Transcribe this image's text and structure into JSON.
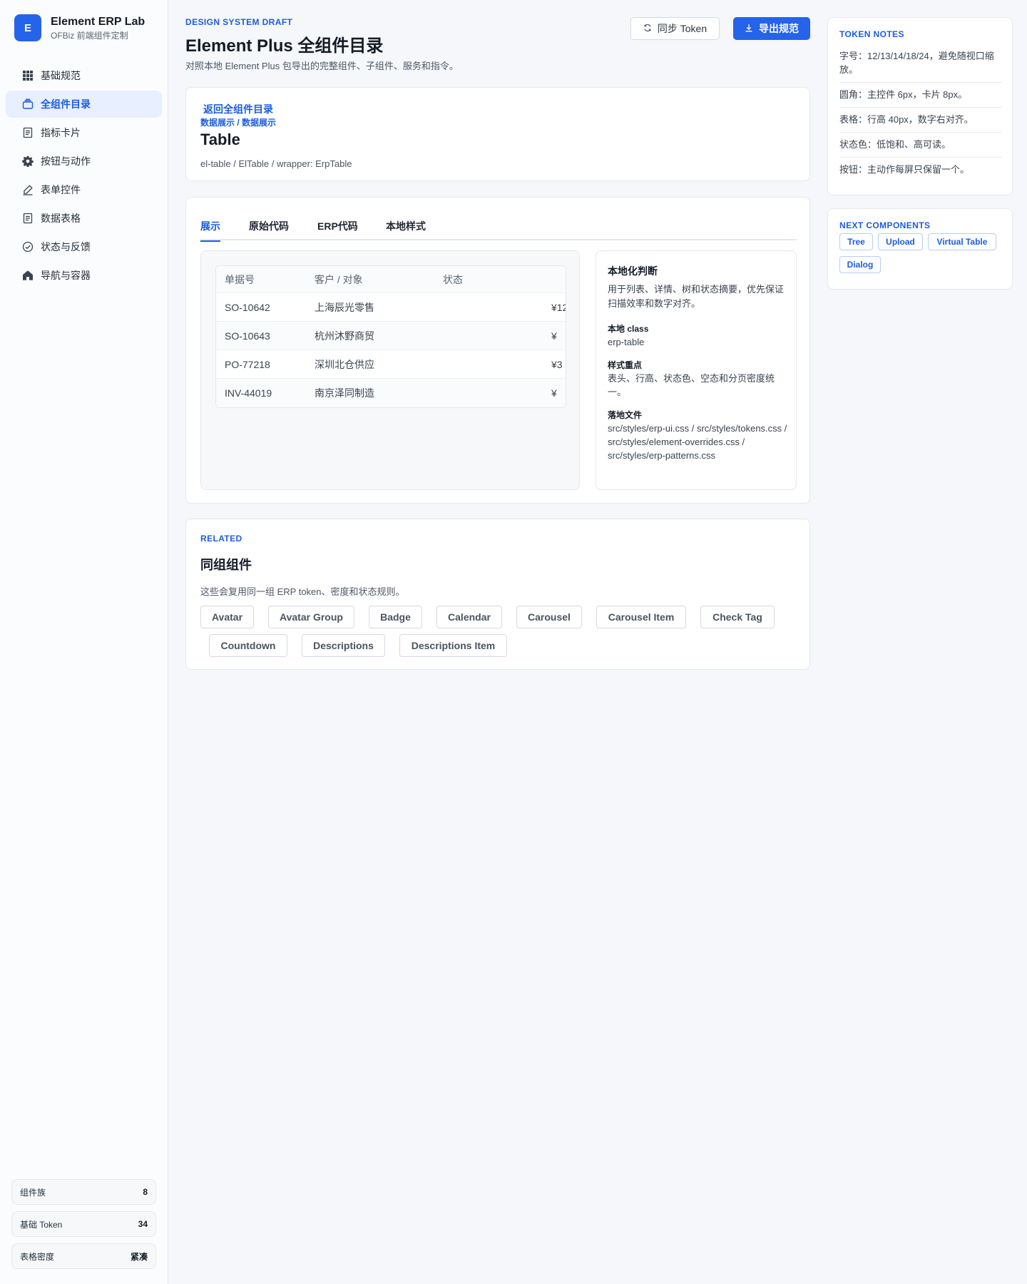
{
  "brand": {
    "logo": "E",
    "name": "Element ERP Lab",
    "subtitle": "OFBiz 前端组件定制"
  },
  "nav": [
    {
      "label": "基础规范",
      "icon": "grid-icon",
      "active": false
    },
    {
      "label": "全组件目录",
      "icon": "layers-icon",
      "active": true
    },
    {
      "label": "指标卡片",
      "icon": "document-icon",
      "active": false
    },
    {
      "label": "按钮与动作",
      "icon": "gear-icon",
      "active": false
    },
    {
      "label": "表单控件",
      "icon": "pen-icon",
      "active": false
    },
    {
      "label": "数据表格",
      "icon": "document-icon",
      "active": false
    },
    {
      "label": "状态与反馈",
      "icon": "check-circle-icon",
      "active": false
    },
    {
      "label": "导航与容器",
      "icon": "home-icon",
      "active": false
    }
  ],
  "stats": [
    {
      "label": "组件族",
      "value": "8"
    },
    {
      "label": "基础 Token",
      "value": "34"
    },
    {
      "label": "表格密度",
      "value": "紧凑"
    }
  ],
  "header": {
    "eyebrow": "DESIGN SYSTEM DRAFT",
    "title": "Element Plus 全组件目录",
    "description": "对照本地 Element Plus 包导出的完整组件、子组件、服务和指令。",
    "sync_label": "同步 Token",
    "export_label": "导出规范"
  },
  "component": {
    "back_label": "返回全组件目录",
    "breadcrumb": "数据展示 / 数据展示",
    "name": "Table",
    "aliases": "el-table / ElTable / wrapper: ErpTable"
  },
  "tabs": [
    "展示",
    "原始代码",
    "ERP代码",
    "本地样式"
  ],
  "table": {
    "headers": [
      "单据号",
      "客户 / 对象",
      "状态"
    ],
    "rows": [
      {
        "id": "SO-10642",
        "customer": "上海辰光零售",
        "amount": "¥12"
      },
      {
        "id": "SO-10643",
        "customer": "杭州沐野商贸",
        "amount": "¥"
      },
      {
        "id": "PO-77218",
        "customer": "深圳北仓供应",
        "amount": "¥3"
      },
      {
        "id": "INV-44019",
        "customer": "南京泽同制造",
        "amount": "¥"
      }
    ]
  },
  "localization": {
    "title": "本地化判断",
    "description": "用于列表、详情、树和状态摘要，优先保证扫描效率和数字对齐。",
    "class_label": "本地 class",
    "class_value": "erp-table",
    "focus_label": "样式重点",
    "focus_value": "表头、行高、状态色、空态和分页密度统一。",
    "files_label": "落地文件",
    "files_value": "src/styles/erp-ui.css / src/styles/tokens.css / src/styles/element-overrides.css / src/styles/erp-patterns.css"
  },
  "related": {
    "eyebrow": "RELATED",
    "title": "同组组件",
    "description": "这些会复用同一组 ERP token、密度和状态规则。",
    "items": [
      "Avatar",
      "Avatar Group",
      "Badge",
      "Calendar",
      "Carousel",
      "Carousel Item",
      "Check Tag",
      "Countdown",
      "Descriptions",
      "Descriptions Item"
    ]
  },
  "token_notes": {
    "eyebrow": "TOKEN NOTES",
    "items": [
      "字号：12/13/14/18/24，避免随视口缩放。",
      "圆角：主控件 6px，卡片 8px。",
      "表格：行高 40px，数字右对齐。",
      "状态色：低饱和、高可读。",
      "按钮：主动作每屏只保留一个。"
    ]
  },
  "next_components": {
    "eyebrow": "NEXT COMPONENTS",
    "items": [
      "Tree",
      "Upload",
      "Virtual Table",
      "Dialog"
    ]
  },
  "colors": {
    "accent": "#2563eb",
    "accent_text": "#1d5ce0",
    "border": "#e4e8ee",
    "page_bg": "#f5f7fa"
  }
}
